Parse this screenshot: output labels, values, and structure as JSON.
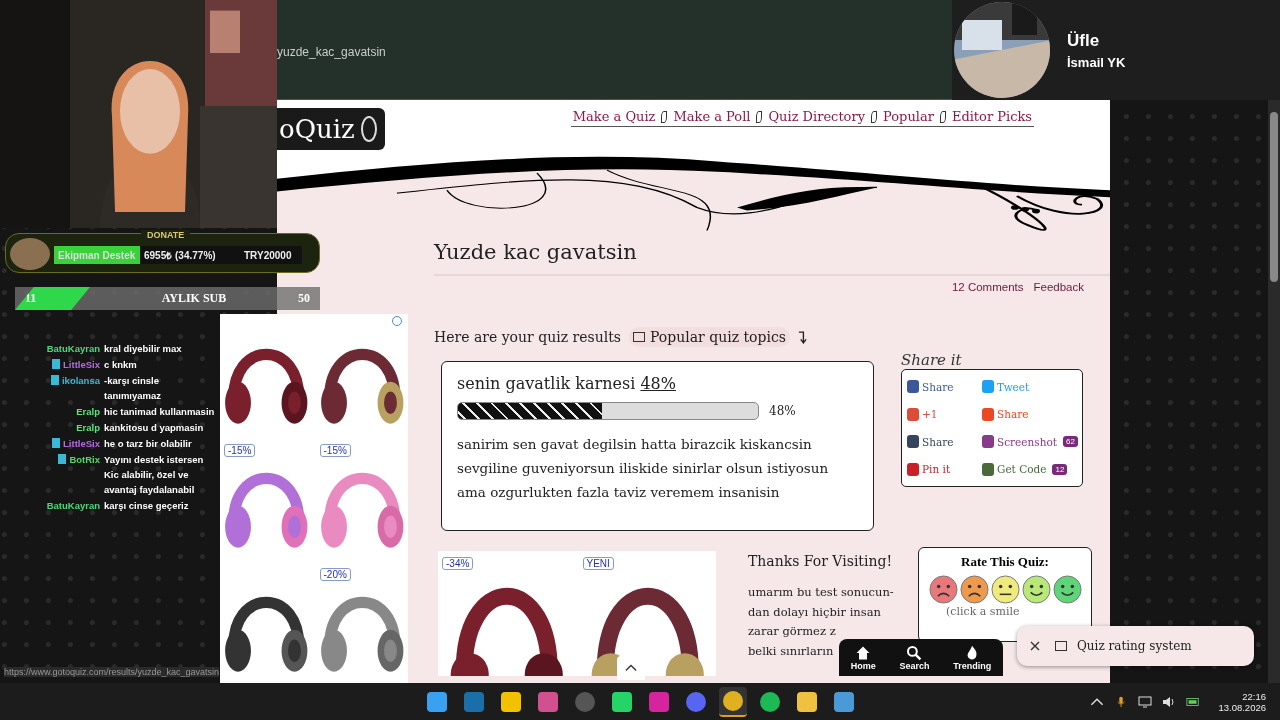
{
  "browser": {
    "address": "yuzde_kac_gavatsin",
    "status_url": "https://www.gotoquiz.com/results/yuzde_kac_gavatsin"
  },
  "now_playing": {
    "title": "Üfle",
    "artist": "İsmail YK"
  },
  "stream_overlay": {
    "webcam": {
      "kind": "picture"
    },
    "donation": {
      "label": "DONATE",
      "goal_name": "Ekipman Destek",
      "amount": "6955₺ (34.77%)",
      "target": "TRY20000",
      "level": 0.3477
    },
    "subs": {
      "current": "11",
      "label": "AYLIK SUB",
      "goal": "50"
    },
    "chat": [
      {
        "user": "BatuKayran",
        "color": "#4cd97b",
        "badge": false,
        "message": "kral diyebilir max"
      },
      {
        "user": "LittleSix",
        "color": "#b56ae6",
        "badge": true,
        "message": "c knkm"
      },
      {
        "user": "ikolansa",
        "color": "#39b9d6",
        "badge": true,
        "message": "-karşı cinsle tanımıyamaz"
      },
      {
        "user": "Eralp",
        "color": "#64e07e",
        "badge": false,
        "message": "hic tanimad kullanmasin"
      },
      {
        "user": "Eralp",
        "color": "#64e07e",
        "badge": false,
        "message": "kankitosu d yapmasin"
      },
      {
        "user": "LittleSix",
        "color": "#b56ae6",
        "badge": true,
        "message": "he o tarz bir olabilir"
      },
      {
        "user": "BotRix",
        "color": "#55d86a",
        "badge": true,
        "message": "Yayını destek istersen Kic alabilir, özel ve avantaj faydalanabil"
      },
      {
        "user": "BatuKayran",
        "color": "#4cd97b",
        "badge": false,
        "message": "karşı cinse geçeriz"
      }
    ]
  },
  "ads": [
    {
      "kind": "picture"
    },
    {
      "kind": "picture"
    },
    {
      "kind": "picture",
      "badge": "-15%"
    },
    {
      "kind": "picture",
      "badge": "-15%"
    },
    {
      "kind": "picture"
    },
    {
      "kind": "picture",
      "badge": "-20%"
    }
  ],
  "site": {
    "logo": "oQuiz",
    "nav": [
      "Make a Quiz",
      "Make a Poll",
      "Quiz Directory",
      "Popular",
      "Editor Picks"
    ],
    "title": "Yuzde kac gavatsin",
    "links": [
      "12 Comments",
      "Feedback"
    ],
    "results_label": "Here are your quiz results",
    "popular_topics": "Popular quiz topics",
    "result": {
      "title": "senin gavatlik karnesi",
      "percent": "48%",
      "level": 0.48,
      "reading": "48%",
      "description": "sanirim sen gavat degilsin hatta birazcik kiskancsin sevgiline guveniyorsun iliskide sinirlar olsun istiyosun ama ozgurlukten fazla taviz veremem insanisin"
    },
    "share_title": "Share it",
    "share": [
      {
        "kind": "facebook",
        "label": "Share"
      },
      {
        "kind": "twitter",
        "label": "Tweet"
      },
      {
        "kind": "google",
        "label": "+1"
      },
      {
        "kind": "stumble",
        "label": "Share"
      },
      {
        "kind": "tumblr",
        "label": "Share"
      },
      {
        "kind": "screenshot",
        "label": "Screenshot",
        "count": "62"
      },
      {
        "kind": "pinterest",
        "label": "Pin it"
      },
      {
        "kind": "code",
        "label": "Get Code",
        "count": "12"
      }
    ],
    "bottom_ads": [
      {
        "kind": "picture",
        "badge": "-34%"
      },
      {
        "kind": "picture",
        "badge": "YENI"
      }
    ],
    "thanks": "Thanks For Visiting!",
    "thanks_lines": [
      "umarım bu test sonucun-",
      "dan dolayı hiçbir insan",
      "zarar görmez z",
      "belki sınırların"
    ],
    "rate": {
      "title": "Rate This Quiz:",
      "hint": "(click a smile",
      "smileys": [
        {
          "color": "#e8787a"
        },
        {
          "color": "#ee9a4e"
        },
        {
          "color": "#eeeb7c"
        },
        {
          "color": "#b7e878"
        },
        {
          "color": "#5fd57a"
        }
      ]
    },
    "bottom_nav": [
      "Home",
      "Search",
      "Trending"
    ],
    "toast": "Quiz rating system"
  },
  "taskbar": {
    "apps": [
      {
        "kind": "windows",
        "active": false
      },
      {
        "kind": "steam",
        "active": false
      },
      {
        "kind": "notes",
        "active": false
      },
      {
        "kind": "snip",
        "active": false
      },
      {
        "kind": "obs",
        "active": false
      },
      {
        "kind": "whatsapp",
        "active": false
      },
      {
        "kind": "instagram",
        "active": false
      },
      {
        "kind": "discord",
        "active": false
      },
      {
        "kind": "chrome",
        "active": true
      },
      {
        "kind": "spotify",
        "active": false
      },
      {
        "kind": "folder",
        "active": false
      },
      {
        "kind": "app",
        "active": false
      }
    ],
    "time": "22:16",
    "date": "13.08.2026"
  }
}
